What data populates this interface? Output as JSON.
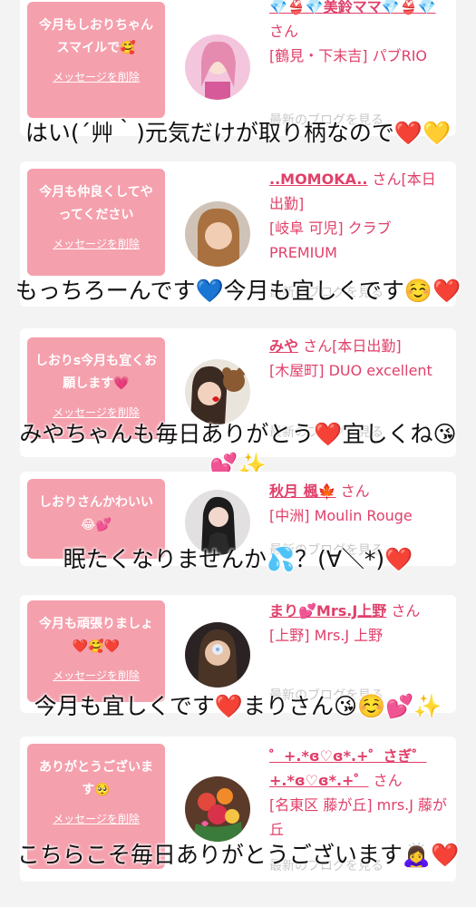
{
  "messages": [
    {
      "bubble_text": "今月もしおりちゃんスマイルで🥰",
      "delete_label": "メッセージを削除",
      "user_name": "💎👙💎美鈴ママ💎👙💎",
      "honorific": "さん",
      "shop": "[鶴見・下末吉] パブRIO",
      "blog_label": "最新のブログを見る",
      "reply": "はい(´艸｀)元気だけが取り柄なので❤️💛"
    },
    {
      "bubble_text": "今月も仲良くしてやってください",
      "delete_label": "メッセージを削除",
      "user_name": "..MOMOKA..",
      "honorific": "さん[本日出勤]",
      "shop": "[岐阜 可児] クラブPREMIUM",
      "blog_label": "最新のブログを見る",
      "reply": "もっちろーんです💙今月も宜しくです☺️❤️"
    },
    {
      "bubble_text": "しおりs今月も宜くお願します💗",
      "delete_label": "メッセージを削除",
      "user_name": "みや",
      "honorific": "さん[本日出勤]",
      "shop": "[木屋町] DUO excellent",
      "blog_label": "最新のブログを見る",
      "reply": "みやちゃんも毎日ありがとう❤️宜しくね😘💕✨"
    },
    {
      "bubble_text": "しおりさんかわいい😂💕",
      "delete_label": "",
      "user_name": "秋月 楓🍁",
      "honorific": "さん",
      "shop": "[中洲] Moulin Rouge",
      "blog_label": "最新のブログを見る",
      "reply": "眠たくなりませんか💦？(∀＼*)❤️"
    },
    {
      "bubble_text": "今月も頑張りましょ❤️🥰❤️",
      "delete_label": "メッセージを削除",
      "user_name": "まり💕Mrs.J上野",
      "honorific": "さん",
      "shop": "[上野] Mrs.J 上野",
      "blog_label": "最新のブログを見る",
      "reply": "今月も宜しくです❤️まりさん😘☺️💕✨"
    },
    {
      "bubble_text": "ありがとうございます🥺",
      "delete_label": "メッセージを削除",
      "user_name": "゜+.*ɞ♡ɞ*.+゜さぎ゜+.*ɞ♡ɞ*.+゜",
      "honorific": "さん",
      "shop": "[名東区 藤が丘] mrs.J 藤が丘",
      "blog_label": "最新のブログを見る",
      "reply": "こちらこそ毎日ありがとうございます🙇‍♀️❤️"
    }
  ],
  "colors": {
    "bubble": "#f5a0ad",
    "accent": "#e0406a",
    "background": "#f3f3f3"
  }
}
